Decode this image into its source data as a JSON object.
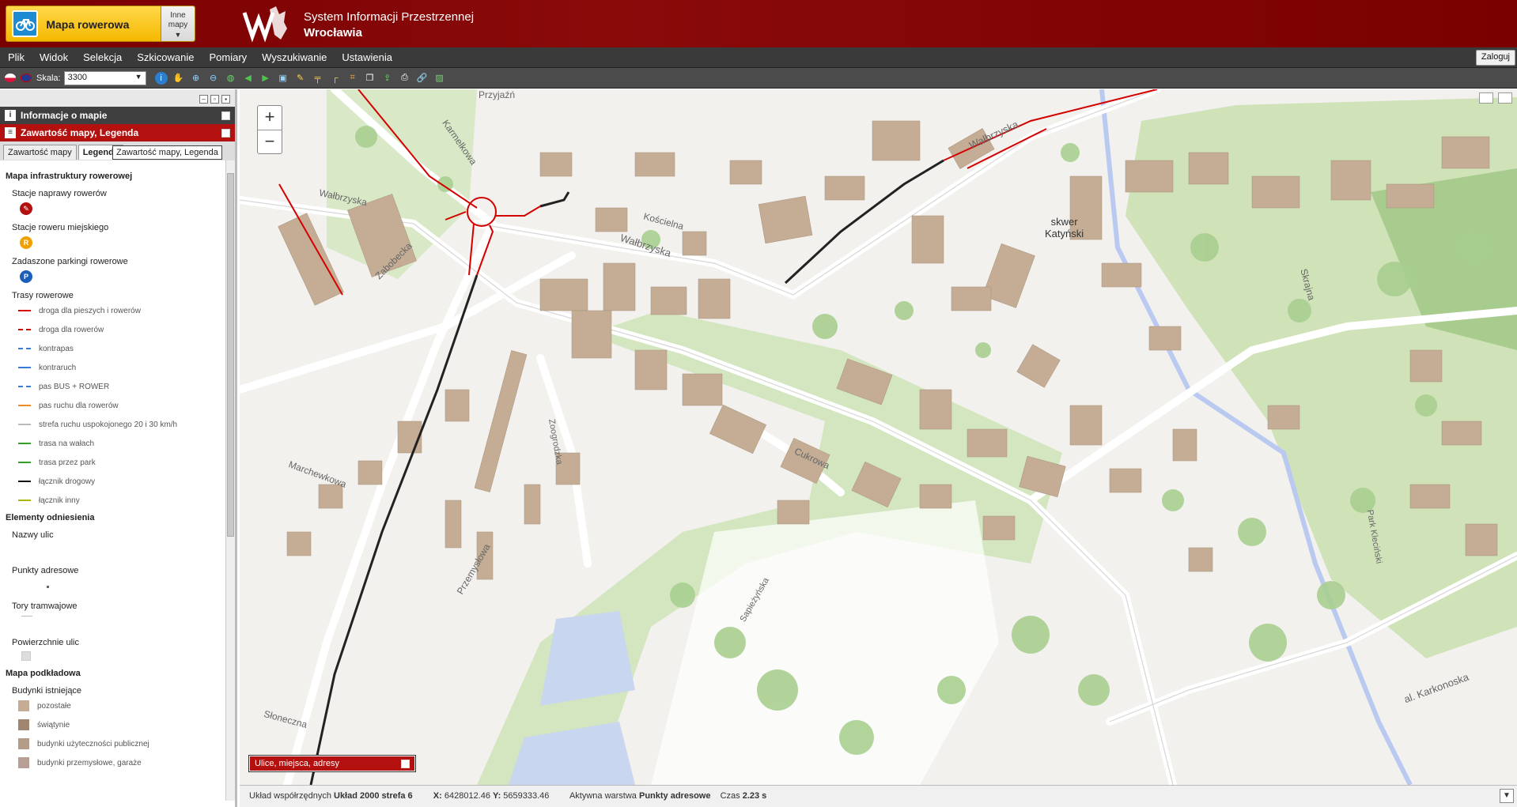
{
  "header": {
    "map_title": "Mapa rowerowa",
    "other_maps_line1": "Inne",
    "other_maps_line2": "mapy",
    "system_title": "System Informacji Przestrzennej",
    "city": "Wrocławia"
  },
  "menu": {
    "items": [
      "Plik",
      "Widok",
      "Selekcja",
      "Szkicowanie",
      "Pomiary",
      "Wyszukiwanie",
      "Ustawienia"
    ],
    "login": "Zaloguj"
  },
  "toolbar": {
    "scale_label": "Skala:",
    "scale_value": "3300"
  },
  "left_panel": {
    "info_header": "Informacje o mapie",
    "legend_header": "Zawartość mapy, Legenda",
    "tab_contents": "Zawartość mapy",
    "tab_legend": "Legenda",
    "tooltip": "Zawartość mapy, Legenda",
    "legend": {
      "section_bike": "Mapa infrastruktury rowerowej",
      "repair": "Stacje naprawy rowerów",
      "city_bike": "Stacje roweru miejskiego",
      "city_bike_symbol": "R",
      "parking": "Zadaszone parkingi rowerowe",
      "parking_symbol": "P",
      "routes": "Trasy rowerowe",
      "route_items": [
        {
          "label": "droga dla pieszych i rowerów",
          "color": "#d40000",
          "style": "solid"
        },
        {
          "label": "droga dla rowerów",
          "color": "#d40000",
          "style": "dashed"
        },
        {
          "label": "kontrapas",
          "color": "#3a7bd5",
          "style": "dashed"
        },
        {
          "label": "kontraruch",
          "color": "#3a7bd5",
          "style": "solid"
        },
        {
          "label": "pas BUS + ROWER",
          "color": "#3a7bd5",
          "style": "dashed"
        },
        {
          "label": "pas ruchu dla rowerów",
          "color": "#f08a24",
          "style": "solid"
        },
        {
          "label": "strefa ruchu uspokojonego 20 i 30 km/h",
          "color": "#bbbbbb",
          "style": "solid"
        },
        {
          "label": "trasa na wałach",
          "color": "#33a02c",
          "style": "solid"
        },
        {
          "label": "trasa przez park",
          "color": "#33a02c",
          "style": "solid"
        },
        {
          "label": "łącznik drogowy",
          "color": "#111111",
          "style": "solid"
        },
        {
          "label": "łącznik inny",
          "color": "#a6b800",
          "style": "solid"
        }
      ],
      "section_ref": "Elementy odniesienia",
      "street_names": "Nazwy ulic",
      "address_points": "Punkty adresowe",
      "tram_tracks": "Tory tramwajowe",
      "street_surfaces": "Powierzchnie ulic",
      "section_base": "Mapa podkładowa",
      "existing_buildings": "Budynki istniejące",
      "building_items": [
        {
          "label": "pozostałe",
          "color": "#c4ad94"
        },
        {
          "label": "świątynie",
          "color": "#a08670"
        },
        {
          "label": "budynki użyteczności publicznej",
          "color": "#b39c88"
        },
        {
          "label": "budynki przemysłowe, garaże",
          "color": "#b89f95"
        }
      ]
    }
  },
  "map": {
    "search_box": "Ulice, miejsca, adresy",
    "labels": {
      "walbrzyska_1": "Wałbrzyska",
      "walbrzyska_2": "Wałbrzyska",
      "walbrzyska_3": "Wałbrzyska",
      "koscielna": "Kościelna",
      "karmelkowa": "Karmelkowa",
      "zaboecka": "Zabobecka",
      "skwer1": "skwer",
      "skwer2": "Katyński",
      "przyjazn": "Przyjaźń",
      "cukrowa": "Cukrowa",
      "skrajna": "Skrajna",
      "park": "Park Kleciński",
      "karkonoska": "al. Karkonoska",
      "marchewkowa": "Marchewkowa",
      "sapiehy": "Sapieżyńska",
      "przemyslowa": "Przemysłowa",
      "zoogrodzka": "Zoogrodzka",
      "slonce": "Słoneczna"
    }
  },
  "status": {
    "coord_label": "Układ współrzędnych",
    "coord_system": "Układ 2000 strefa 6",
    "x_label": "X:",
    "x_value": "6428012.46",
    "y_label": "Y:",
    "y_value": "5659333.46",
    "layer_label": "Aktywna warstwa",
    "layer_value": "Punkty adresowe",
    "time_label": "Czas",
    "time_value": "2.23 s"
  }
}
